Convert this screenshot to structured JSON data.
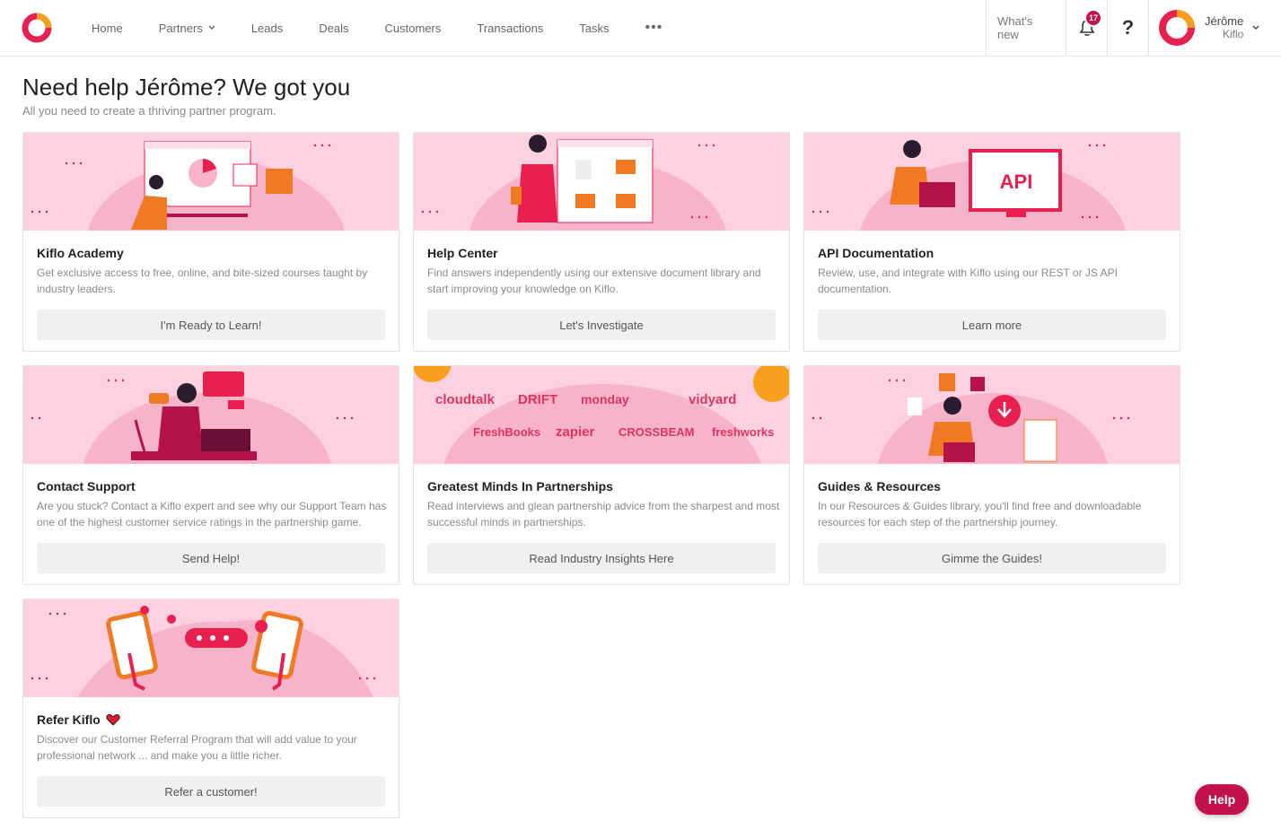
{
  "nav": {
    "items": [
      "Home",
      "Partners",
      "Leads",
      "Deals",
      "Customers",
      "Transactions",
      "Tasks"
    ],
    "more": "•••"
  },
  "topright": {
    "whats_new": "What's new",
    "notifications": "17",
    "help": "?",
    "user_name": "Jérôme",
    "user_org": "Kiflo"
  },
  "page": {
    "title": "Need help Jérôme? We got you",
    "subtitle": "All you need to create a thriving partner program."
  },
  "cards": [
    {
      "title": "Kiflo Academy",
      "desc": "Get exclusive access to free, online, and bite-sized courses taught by industry leaders.",
      "button": "I'm Ready to Learn!"
    },
    {
      "title": "Help Center",
      "desc": "Find answers independently using our extensive document library and start improving your knowledge on Kiflo.",
      "button": "Let's Investigate"
    },
    {
      "title": "API Documentation",
      "desc": "Review, use, and integrate with Kiflo using our REST or JS API documentation.",
      "button": "Learn more"
    },
    {
      "title": "Contact Support",
      "desc": "Are you stuck? Contact a Kiflo expert and see why our Support Team has one of the highest customer service ratings in the partnership game.",
      "button": "Send Help!"
    },
    {
      "title": "Greatest Minds In Partnerships",
      "desc": "Read interviews and glean partnership advice from the sharpest and most successful minds in partnerships.",
      "button": "Read Industry Insights Here"
    },
    {
      "title": "Guides & Resources",
      "desc": "In our Resources & Guides library, you'll find free and downloadable resources for each step of the partnership journey.",
      "button": "Gimme the Guides!"
    },
    {
      "title": "Refer Kiflo",
      "desc": "Discover our Customer Referral Program that will add value to your professional network ... and make you a little richer.",
      "button": "Refer a customer!"
    }
  ],
  "banner_text": {
    "api": "API",
    "logos": [
      "cloudtalk",
      "DRIFT",
      "monday",
      "vidyard",
      "FreshBooks",
      "zapier",
      "CROSSBEAM",
      "freshworks"
    ]
  },
  "help_button": "Help",
  "colors": {
    "accent": "#c2124e",
    "banner_bg": "#fdd1df",
    "orange": "#f07a22"
  }
}
